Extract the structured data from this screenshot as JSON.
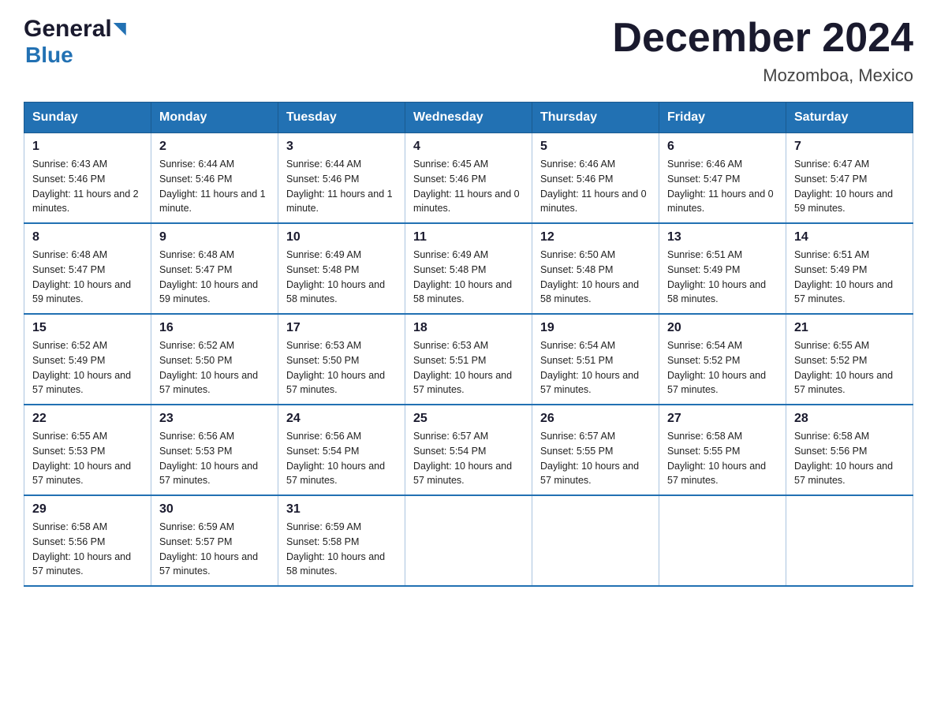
{
  "header": {
    "logo_general": "General",
    "logo_blue": "Blue",
    "month_title": "December 2024",
    "location": "Mozomboa, Mexico"
  },
  "days_of_week": [
    "Sunday",
    "Monday",
    "Tuesday",
    "Wednesday",
    "Thursday",
    "Friday",
    "Saturday"
  ],
  "weeks": [
    [
      {
        "day": "1",
        "sunrise": "6:43 AM",
        "sunset": "5:46 PM",
        "daylight": "11 hours and 2 minutes."
      },
      {
        "day": "2",
        "sunrise": "6:44 AM",
        "sunset": "5:46 PM",
        "daylight": "11 hours and 1 minute."
      },
      {
        "day": "3",
        "sunrise": "6:44 AM",
        "sunset": "5:46 PM",
        "daylight": "11 hours and 1 minute."
      },
      {
        "day": "4",
        "sunrise": "6:45 AM",
        "sunset": "5:46 PM",
        "daylight": "11 hours and 0 minutes."
      },
      {
        "day": "5",
        "sunrise": "6:46 AM",
        "sunset": "5:46 PM",
        "daylight": "11 hours and 0 minutes."
      },
      {
        "day": "6",
        "sunrise": "6:46 AM",
        "sunset": "5:47 PM",
        "daylight": "11 hours and 0 minutes."
      },
      {
        "day": "7",
        "sunrise": "6:47 AM",
        "sunset": "5:47 PM",
        "daylight": "10 hours and 59 minutes."
      }
    ],
    [
      {
        "day": "8",
        "sunrise": "6:48 AM",
        "sunset": "5:47 PM",
        "daylight": "10 hours and 59 minutes."
      },
      {
        "day": "9",
        "sunrise": "6:48 AM",
        "sunset": "5:47 PM",
        "daylight": "10 hours and 59 minutes."
      },
      {
        "day": "10",
        "sunrise": "6:49 AM",
        "sunset": "5:48 PM",
        "daylight": "10 hours and 58 minutes."
      },
      {
        "day": "11",
        "sunrise": "6:49 AM",
        "sunset": "5:48 PM",
        "daylight": "10 hours and 58 minutes."
      },
      {
        "day": "12",
        "sunrise": "6:50 AM",
        "sunset": "5:48 PM",
        "daylight": "10 hours and 58 minutes."
      },
      {
        "day": "13",
        "sunrise": "6:51 AM",
        "sunset": "5:49 PM",
        "daylight": "10 hours and 58 minutes."
      },
      {
        "day": "14",
        "sunrise": "6:51 AM",
        "sunset": "5:49 PM",
        "daylight": "10 hours and 57 minutes."
      }
    ],
    [
      {
        "day": "15",
        "sunrise": "6:52 AM",
        "sunset": "5:49 PM",
        "daylight": "10 hours and 57 minutes."
      },
      {
        "day": "16",
        "sunrise": "6:52 AM",
        "sunset": "5:50 PM",
        "daylight": "10 hours and 57 minutes."
      },
      {
        "day": "17",
        "sunrise": "6:53 AM",
        "sunset": "5:50 PM",
        "daylight": "10 hours and 57 minutes."
      },
      {
        "day": "18",
        "sunrise": "6:53 AM",
        "sunset": "5:51 PM",
        "daylight": "10 hours and 57 minutes."
      },
      {
        "day": "19",
        "sunrise": "6:54 AM",
        "sunset": "5:51 PM",
        "daylight": "10 hours and 57 minutes."
      },
      {
        "day": "20",
        "sunrise": "6:54 AM",
        "sunset": "5:52 PM",
        "daylight": "10 hours and 57 minutes."
      },
      {
        "day": "21",
        "sunrise": "6:55 AM",
        "sunset": "5:52 PM",
        "daylight": "10 hours and 57 minutes."
      }
    ],
    [
      {
        "day": "22",
        "sunrise": "6:55 AM",
        "sunset": "5:53 PM",
        "daylight": "10 hours and 57 minutes."
      },
      {
        "day": "23",
        "sunrise": "6:56 AM",
        "sunset": "5:53 PM",
        "daylight": "10 hours and 57 minutes."
      },
      {
        "day": "24",
        "sunrise": "6:56 AM",
        "sunset": "5:54 PM",
        "daylight": "10 hours and 57 minutes."
      },
      {
        "day": "25",
        "sunrise": "6:57 AM",
        "sunset": "5:54 PM",
        "daylight": "10 hours and 57 minutes."
      },
      {
        "day": "26",
        "sunrise": "6:57 AM",
        "sunset": "5:55 PM",
        "daylight": "10 hours and 57 minutes."
      },
      {
        "day": "27",
        "sunrise": "6:58 AM",
        "sunset": "5:55 PM",
        "daylight": "10 hours and 57 minutes."
      },
      {
        "day": "28",
        "sunrise": "6:58 AM",
        "sunset": "5:56 PM",
        "daylight": "10 hours and 57 minutes."
      }
    ],
    [
      {
        "day": "29",
        "sunrise": "6:58 AM",
        "sunset": "5:56 PM",
        "daylight": "10 hours and 57 minutes."
      },
      {
        "day": "30",
        "sunrise": "6:59 AM",
        "sunset": "5:57 PM",
        "daylight": "10 hours and 57 minutes."
      },
      {
        "day": "31",
        "sunrise": "6:59 AM",
        "sunset": "5:58 PM",
        "daylight": "10 hours and 58 minutes."
      },
      null,
      null,
      null,
      null
    ]
  ]
}
